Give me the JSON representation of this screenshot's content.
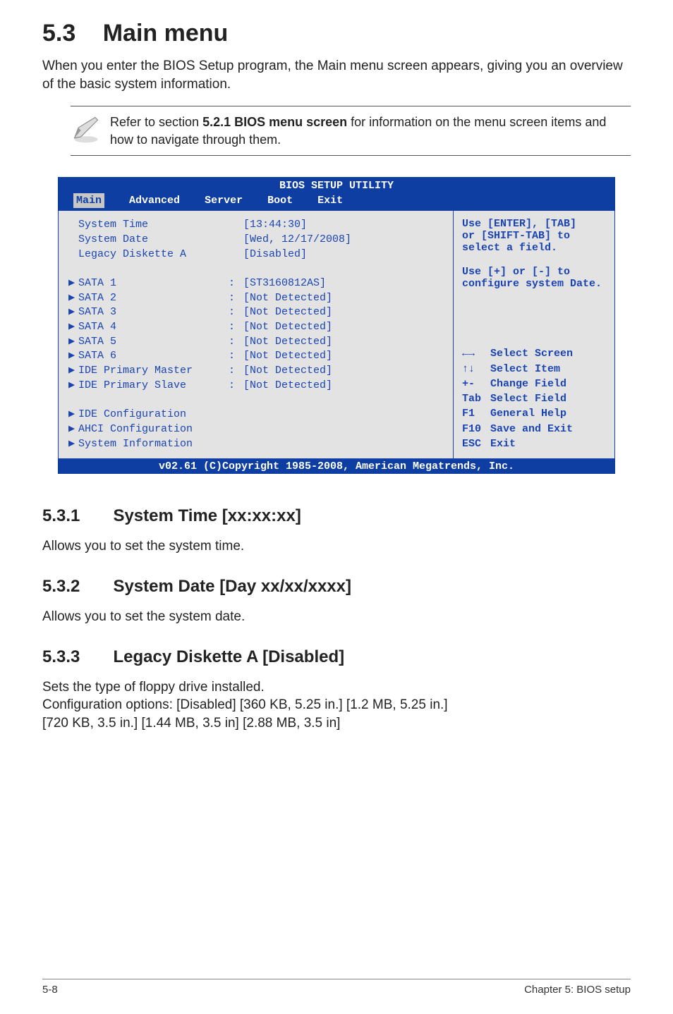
{
  "heading": {
    "num": "5.3",
    "title": "Main menu"
  },
  "intro": "When you enter the BIOS Setup program, the Main menu screen appears, giving you an overview of the basic system information.",
  "note": "Refer to section 5.2.1 BIOS menu screen for information on the menu screen items and how to navigate through them.",
  "note_bold": "5.2.1 BIOS menu screen",
  "bios": {
    "title": "BIOS SETUP UTILITY",
    "tabs": [
      "Main",
      "Advanced",
      "Server",
      "Boot",
      "Exit"
    ],
    "active_tab": "Main",
    "top_rows": [
      {
        "label": "System Time",
        "value": "[13:44:30]"
      },
      {
        "label": "System Date",
        "value": "[Wed, 12/17/2008]"
      },
      {
        "label": "Legacy Diskette A",
        "value": "[Disabled]"
      }
    ],
    "dev_rows": [
      {
        "label": "SATA 1",
        "value": "[ST3160812AS]"
      },
      {
        "label": "SATA 2",
        "value": "[Not Detected]"
      },
      {
        "label": "SATA 3",
        "value": "[Not Detected]"
      },
      {
        "label": "SATA 4",
        "value": "[Not Detected]"
      },
      {
        "label": "SATA 5",
        "value": "[Not Detected]"
      },
      {
        "label": "SATA 6",
        "value": "[Not Detected]"
      },
      {
        "label": "IDE Primary Master",
        "value": "[Not Detected]"
      },
      {
        "label": "IDE Primary Slave",
        "value": "[Not Detected]"
      }
    ],
    "menu_rows": [
      "IDE Configuration",
      "AHCI Configuration",
      "System Information"
    ],
    "help_top": [
      "Use [ENTER], [TAB]",
      "or [SHIFT-TAB] to",
      "select a field.",
      "",
      "Use [+] or [-] to",
      "configure system Date."
    ],
    "help_keys": [
      {
        "k": "←→",
        "t": "Select Screen"
      },
      {
        "k": "↑↓",
        "t": "Select Item"
      },
      {
        "k": "+-",
        "t": "Change Field"
      },
      {
        "k": "Tab",
        "t": "Select Field"
      },
      {
        "k": "F1",
        "t": "General Help"
      },
      {
        "k": "F10",
        "t": "Save and Exit"
      },
      {
        "k": "ESC",
        "t": "Exit"
      }
    ],
    "footer": "v02.61 (C)Copyright 1985-2008, American Megatrends, Inc."
  },
  "sections": [
    {
      "num": "5.3.1",
      "title": "System Time [xx:xx:xx]",
      "body": "Allows you to set the system time."
    },
    {
      "num": "5.3.2",
      "title": "System Date [Day xx/xx/xxxx]",
      "body": "Allows you to set the system date."
    },
    {
      "num": "5.3.3",
      "title": "Legacy Diskette A [Disabled]",
      "body": "Sets the type of floppy drive installed.\nConfiguration options: [Disabled] [360 KB, 5.25 in.] [1.2 MB, 5.25 in.]\n[720 KB, 3.5 in.] [1.44 MB, 3.5 in] [2.88 MB, 3.5 in]"
    }
  ],
  "footer": {
    "left": "5-8",
    "right": "Chapter 5: BIOS setup"
  }
}
